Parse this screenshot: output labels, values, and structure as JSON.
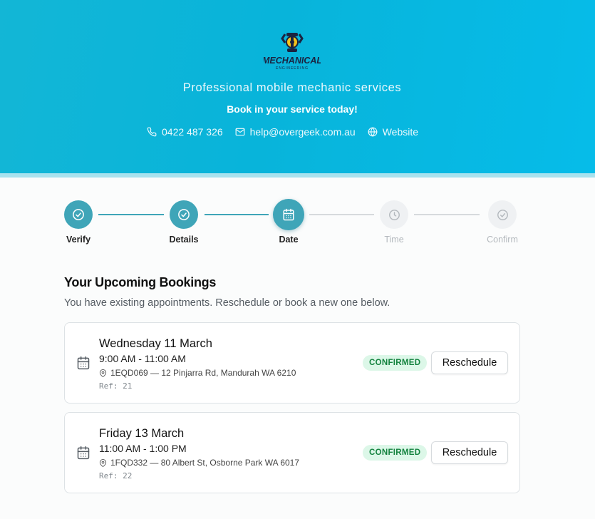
{
  "header": {
    "logo": {
      "main_text": "MECHANICAL",
      "sub_text": "ENGINEERING"
    },
    "tagline": "Professional mobile mechanic services",
    "cta": "Book in your service today!",
    "contacts": [
      {
        "icon": "phone-icon",
        "text": "0422 487 326"
      },
      {
        "icon": "mail-icon",
        "text": "help@overgeek.com.au"
      },
      {
        "icon": "globe-icon",
        "text": "Website"
      }
    ]
  },
  "stepper": {
    "steps": [
      {
        "label": "Verify",
        "state": "done"
      },
      {
        "label": "Details",
        "state": "done"
      },
      {
        "label": "Date",
        "state": "active"
      },
      {
        "label": "Time",
        "state": "todo"
      },
      {
        "label": "Confirm",
        "state": "todo"
      }
    ]
  },
  "bookings": {
    "title": "Your Upcoming Bookings",
    "subtitle": "You have existing appointments. Reschedule or book a new one below.",
    "items": [
      {
        "day": "Wednesday 11 March",
        "time": "9:00 AM - 11:00 AM",
        "address": "1EQD069 — 12 Pinjarra Rd, Mandurah WA 6210",
        "ref": "Ref: 21",
        "status": "CONFIRMED",
        "action": "Reschedule"
      },
      {
        "day": "Friday 13 March",
        "time": "11:00 AM - 1:00 PM",
        "address": "1FQD332 — 80 Albert St, Osborne Park WA 6017",
        "ref": "Ref: 22",
        "status": "CONFIRMED",
        "action": "Reschedule"
      }
    ]
  },
  "colors": {
    "header_bg": "#08b4da",
    "accent": "#3fa5b8",
    "confirmed_bg": "#dcf7e8",
    "confirmed_text": "#14833f"
  }
}
